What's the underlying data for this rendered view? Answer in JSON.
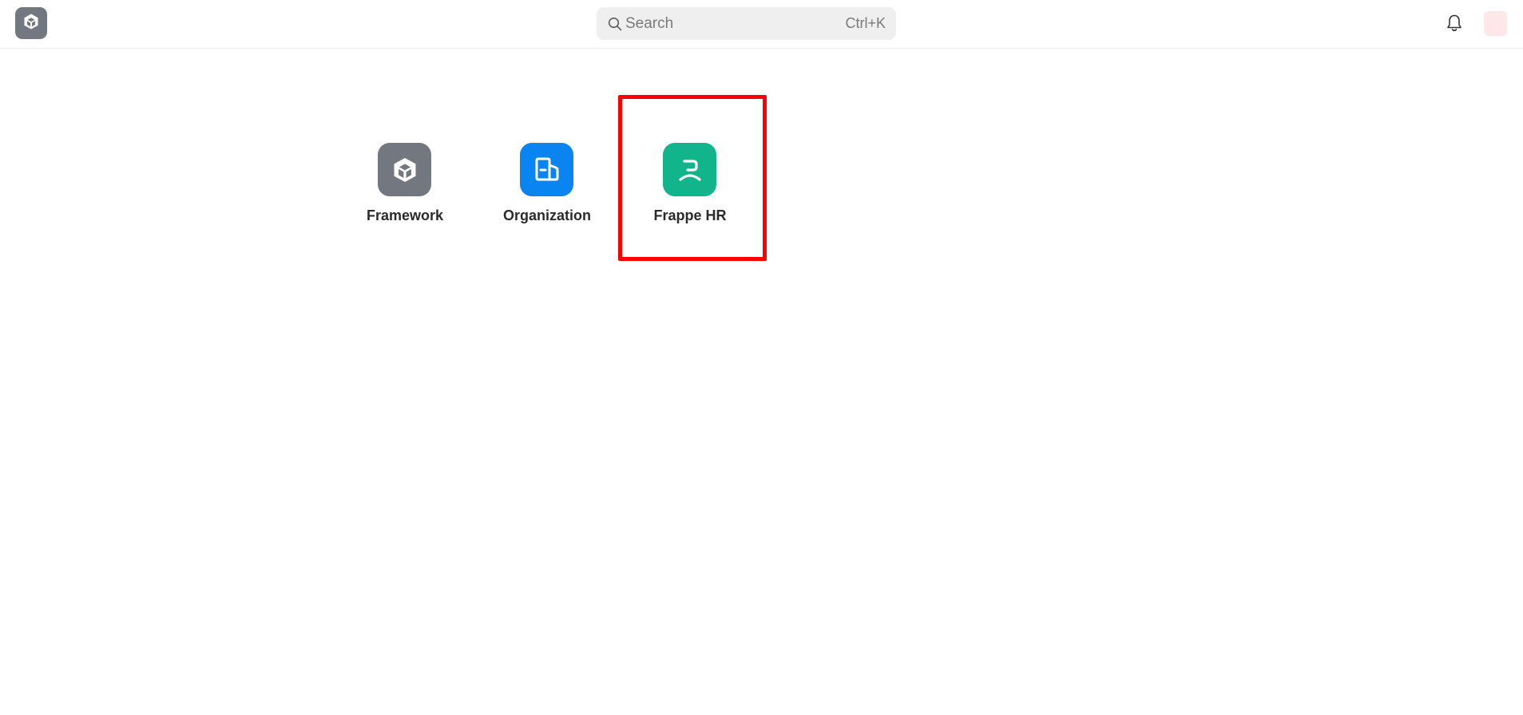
{
  "header": {
    "logo_icon": "cube-icon",
    "search": {
      "placeholder": "Search",
      "value": "",
      "shortcut": "Ctrl+K"
    },
    "notifications_icon": "bell-icon",
    "avatar_color": "#fde7e7"
  },
  "apps": [
    {
      "label": "Framework",
      "icon": "cube-icon",
      "color": "#737780"
    },
    {
      "label": "Organization",
      "icon": "building-icon",
      "color": "#0a84f0"
    },
    {
      "label": "Frappe HR",
      "icon": "frappe-hr-icon",
      "color": "#12b48c"
    }
  ]
}
